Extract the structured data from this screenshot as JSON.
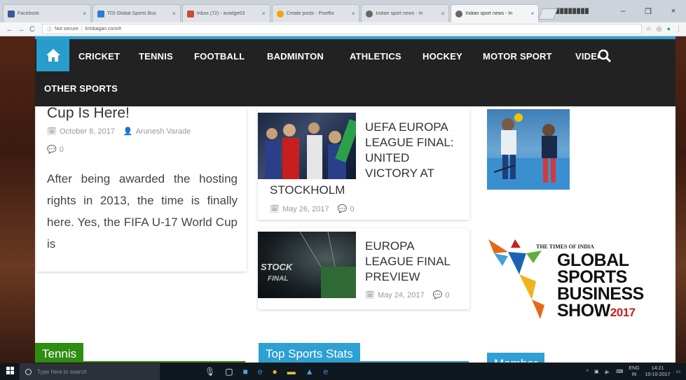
{
  "browser": {
    "tabs": [
      {
        "title": "Facebook",
        "fav_color": "#3b5998",
        "active": false
      },
      {
        "title": "TOI Global Sports Bus",
        "fav_color": "#2a7fd4",
        "active": false
      },
      {
        "title": "Inbox (72) - avadge03",
        "fav_color": "#d14836",
        "active": false
      },
      {
        "title": "Create posts - Pixeffix",
        "fav_color": "#f4a300",
        "active": false
      },
      {
        "title": "Indian sport news - In",
        "fav_color": "#666666",
        "active": false
      },
      {
        "title": "Indian sport news - In",
        "fav_color": "#666666",
        "active": true
      }
    ],
    "tab_close": "×",
    "profile": "████████",
    "window_controls": [
      "–",
      "❐",
      "×"
    ],
    "nav": {
      "back": "←",
      "forward": "→",
      "reload": "C"
    },
    "address": {
      "security": "Not secure",
      "url": "krisbagan.com/#"
    },
    "extension_icons": [
      "☆",
      "◎",
      "●",
      "⋮"
    ]
  },
  "site": {
    "nav": {
      "home_icon": "home-icon",
      "items": [
        "CRICKET",
        "TENNIS",
        "FOOTBALL",
        "BADMINTON",
        "ATHLETICS",
        "HOCKEY",
        "MOTOR SPORT",
        "VIDEO",
        "OTHER SPORTS"
      ]
    },
    "left_post": {
      "title": "Cup Is Here!",
      "date": "October 8, 2017",
      "author": "Arunesh Varade",
      "comments": "0",
      "excerpt": "After being awarded the hosting rights in 2013, the time is finally here. Yes, the FIFA U-17 World Cup is"
    },
    "mid_posts": [
      {
        "title_lines": [
          "UEFA EUROPA",
          "LEAGUE FINAL:",
          "UNITED",
          "VICTORY AT"
        ],
        "title_tail": "STOCKHOLM",
        "date": "May 26, 2017",
        "comments": "0"
      },
      {
        "title_lines": [
          "EUROPA",
          "LEAGUE FINAL",
          "PREVIEW"
        ],
        "title_tail": "",
        "date": "May 24, 2017",
        "comments": "0",
        "thumb_text": [
          "STOCK",
          "FINAL"
        ]
      }
    ],
    "ad": {
      "kicker": "THE TIMES OF INDIA",
      "lines": [
        "GLOBAL",
        "SPORTS",
        "BUSINESS"
      ],
      "show": "SHOW",
      "year": "2017"
    },
    "widgets": [
      {
        "title": "Tennis",
        "color": "#2f8d12"
      },
      {
        "title": "Top Sports Stats",
        "color": "#2ea0d4"
      },
      {
        "title": "Member",
        "color": "#2ea0d4"
      }
    ],
    "colors": {
      "accent": "#289dcc",
      "nav_bg": "#222222",
      "ad_red": "#c8201c"
    }
  },
  "taskbar": {
    "search_placeholder": "Type here to search",
    "tray": {
      "lang": "ENG",
      "region": "IN",
      "time": "14:21",
      "date": "10-10-2017"
    }
  }
}
